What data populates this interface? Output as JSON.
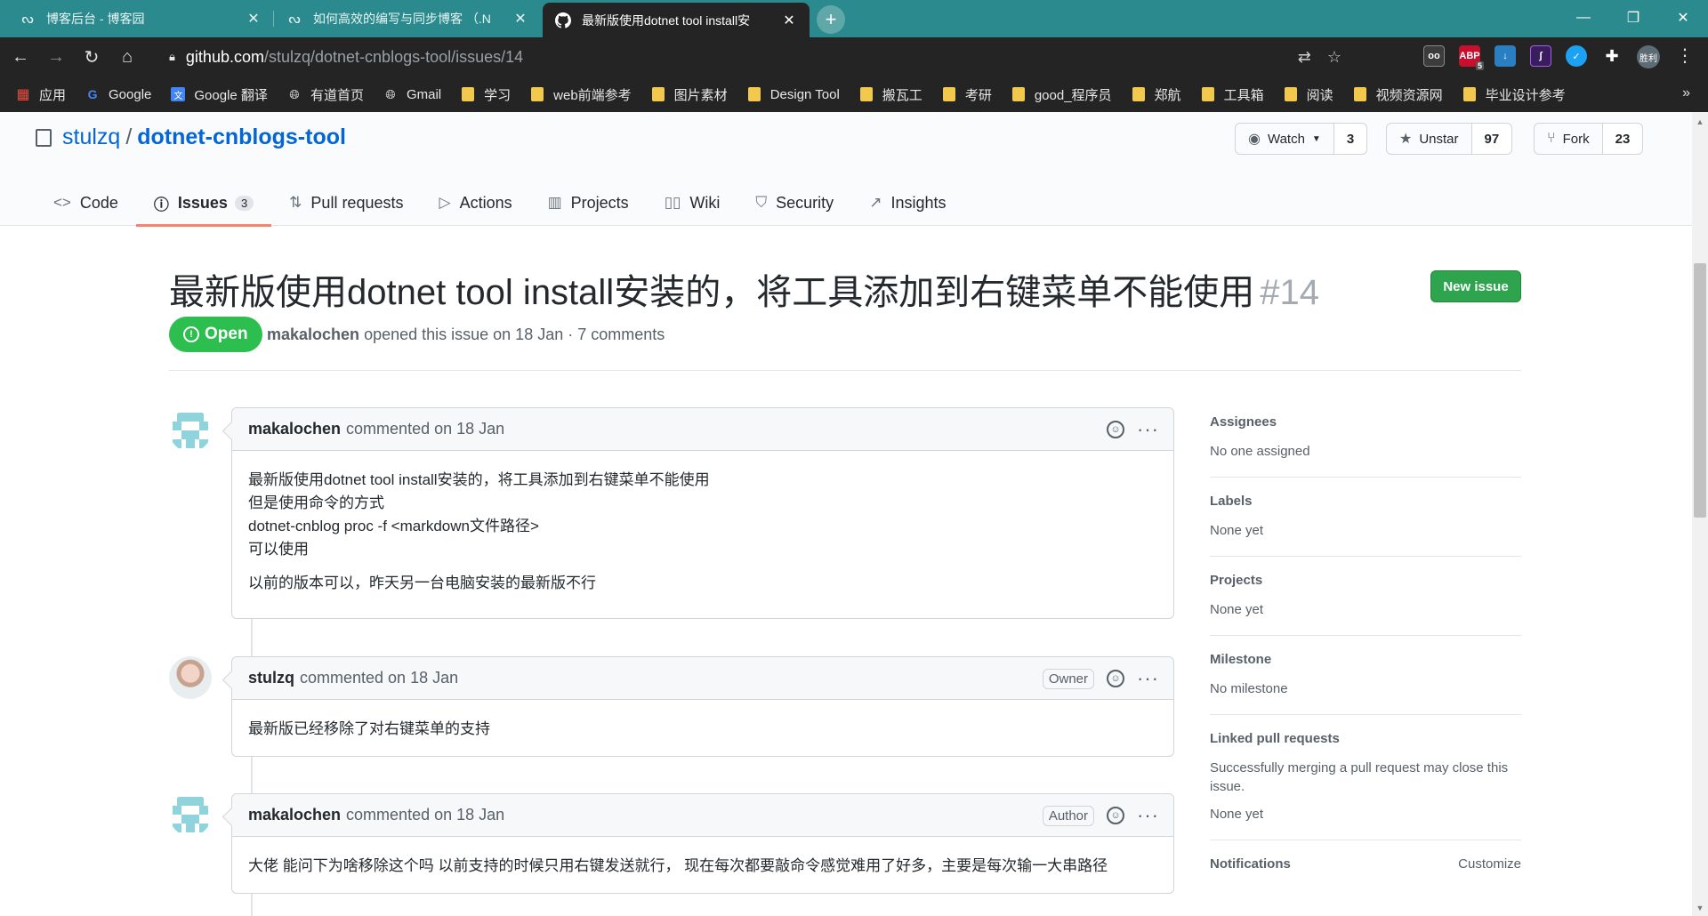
{
  "browser": {
    "tabs": [
      {
        "title": "博客后台 - 博客园",
        "icon": "cnblogs-icon"
      },
      {
        "title": "如何高效的编写与同步博客 （.N",
        "icon": "cnblogs-icon"
      },
      {
        "title": "最新版使用dotnet tool install安",
        "icon": "github-icon"
      }
    ],
    "url_host": "github.com",
    "url_path": "/stulzq/dotnet-cnblogs-tool/issues/14",
    "extension_badge": "5",
    "profile_label": "胜利",
    "bookmarks": [
      {
        "label": "应用",
        "icon": "apps-grid-icon"
      },
      {
        "label": "Google",
        "icon": "google-icon"
      },
      {
        "label": "Google 翻译",
        "icon": "translate-icon"
      },
      {
        "label": "有道首页",
        "icon": "globe-icon"
      },
      {
        "label": "Gmail",
        "icon": "globe-icon"
      },
      {
        "label": "学习",
        "icon": "folder-icon"
      },
      {
        "label": "web前端参考",
        "icon": "folder-icon"
      },
      {
        "label": "图片素材",
        "icon": "folder-icon"
      },
      {
        "label": "Design Tool",
        "icon": "folder-icon"
      },
      {
        "label": "搬瓦工",
        "icon": "folder-icon"
      },
      {
        "label": "考研",
        "icon": "folder-icon"
      },
      {
        "label": "good_程序员",
        "icon": "folder-icon"
      },
      {
        "label": "郑航",
        "icon": "folder-icon"
      },
      {
        "label": "工具箱",
        "icon": "folder-icon"
      },
      {
        "label": "阅读",
        "icon": "folder-icon"
      },
      {
        "label": "视频资源网",
        "icon": "folder-icon"
      },
      {
        "label": "毕业设计参考",
        "icon": "folder-icon"
      }
    ]
  },
  "repo": {
    "owner": "stulzq",
    "separator": "/",
    "name": "dotnet-cnblogs-tool",
    "watch_label": "Watch",
    "watch_count": "3",
    "star_label": "Unstar",
    "star_count": "97",
    "fork_label": "Fork",
    "fork_count": "23",
    "nav": [
      {
        "label": "Code",
        "icon": "code-icon"
      },
      {
        "label": "Issues",
        "icon": "issue-opened-icon",
        "counter": "3"
      },
      {
        "label": "Pull requests",
        "icon": "git-pull-request-icon"
      },
      {
        "label": "Actions",
        "icon": "play-icon"
      },
      {
        "label": "Projects",
        "icon": "project-icon"
      },
      {
        "label": "Wiki",
        "icon": "book-icon"
      },
      {
        "label": "Security",
        "icon": "shield-icon"
      },
      {
        "label": "Insights",
        "icon": "graph-icon"
      }
    ]
  },
  "issue": {
    "title": "最新版使用dotnet tool install安装的，将工具添加到右键菜单不能使用",
    "number": "#14",
    "new_issue_label": "New issue",
    "state": "Open",
    "author": "makalochen",
    "meta_text": "opened this issue on 18 Jan · 7 comments"
  },
  "comments": [
    {
      "author": "makalochen",
      "action": "commented on 18 Jan",
      "role": "",
      "lines": [
        "最新版使用dotnet tool install安装的，将工具添加到右键菜单不能使用",
        "但是使用命令的方式",
        "dotnet-cnblog proc -f <markdown文件路径>",
        "可以使用"
      ],
      "para2": "以前的版本可以，昨天另一台电脑安装的最新版不行"
    },
    {
      "author": "stulzq",
      "action": "commented on 18 Jan",
      "role": "Owner",
      "body": "最新版已经移除了对右键菜单的支持"
    },
    {
      "author": "makalochen",
      "action": "commented on 18 Jan",
      "role": "Author",
      "body": "大佬 能问下为啥移除这个吗 以前支持的时候只用右键发送就行， 现在每次都要敲命令感觉难用了好多，主要是每次输一大串路径"
    }
  ],
  "sidebar": {
    "assignees": {
      "heading": "Assignees",
      "value": "No one assigned"
    },
    "labels": {
      "heading": "Labels",
      "value": "None yet"
    },
    "projects": {
      "heading": "Projects",
      "value": "None yet"
    },
    "milestone": {
      "heading": "Milestone",
      "value": "No milestone"
    },
    "linked": {
      "heading": "Linked pull requests",
      "value": "Successfully merging a pull request may close this issue.",
      "value2": "None yet"
    },
    "notifications": {
      "heading": "Notifications",
      "action": "Customize"
    }
  },
  "colors": {
    "tabstrip": "#2b8a8d",
    "chrome_dark": "#242424",
    "link": "#0366d6",
    "open_state": "#2cbe4e",
    "new_issue": "#2ea44f",
    "nav_underline": "#f9826c",
    "identicon": "#8fd3dd"
  }
}
